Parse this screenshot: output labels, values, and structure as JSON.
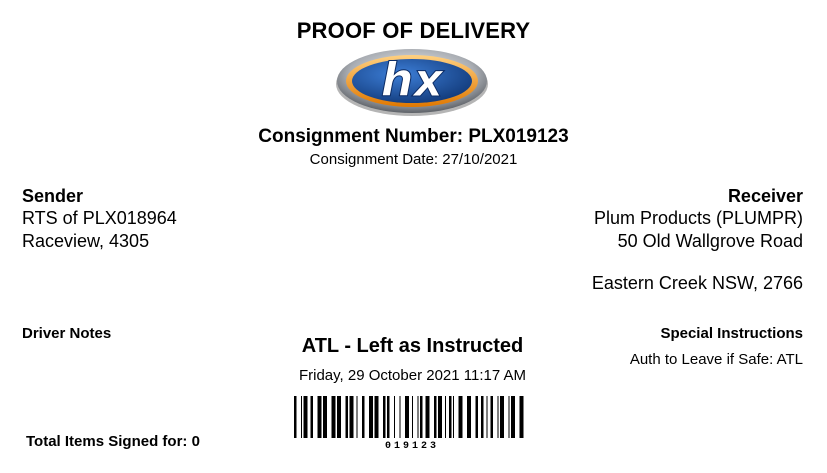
{
  "document": {
    "title": "PROOF OF DELIVERY",
    "logo_text": "hx",
    "consignment_number": "Consignment Number: PLX019123",
    "consignment_date": "Consignment Date: 27/10/2021"
  },
  "sender": {
    "heading": "Sender",
    "line1": "RTS of PLX018964",
    "line2": "Raceview, 4305"
  },
  "receiver": {
    "heading": "Receiver",
    "line1": "Plum Products (PLUMPR)",
    "line2": "50 Old Wallgrove Road",
    "line3": "Eastern Creek NSW, 2766"
  },
  "driver_notes": {
    "heading": "Driver Notes"
  },
  "special_instructions": {
    "heading": "Special Instructions",
    "text": "Auth to Leave if Safe: ATL"
  },
  "delivery": {
    "status": "ATL - Left as Instructed",
    "datetime": "Friday, 29 October 2021 11:17 AM"
  },
  "barcode": {
    "number": "019123"
  },
  "total_items": {
    "label": "Total Items Signed for: 0"
  },
  "colors": {
    "logo_blue": "#1f4f9c",
    "logo_orange": "#f39a1e",
    "logo_silver": "#b8bcc2"
  }
}
